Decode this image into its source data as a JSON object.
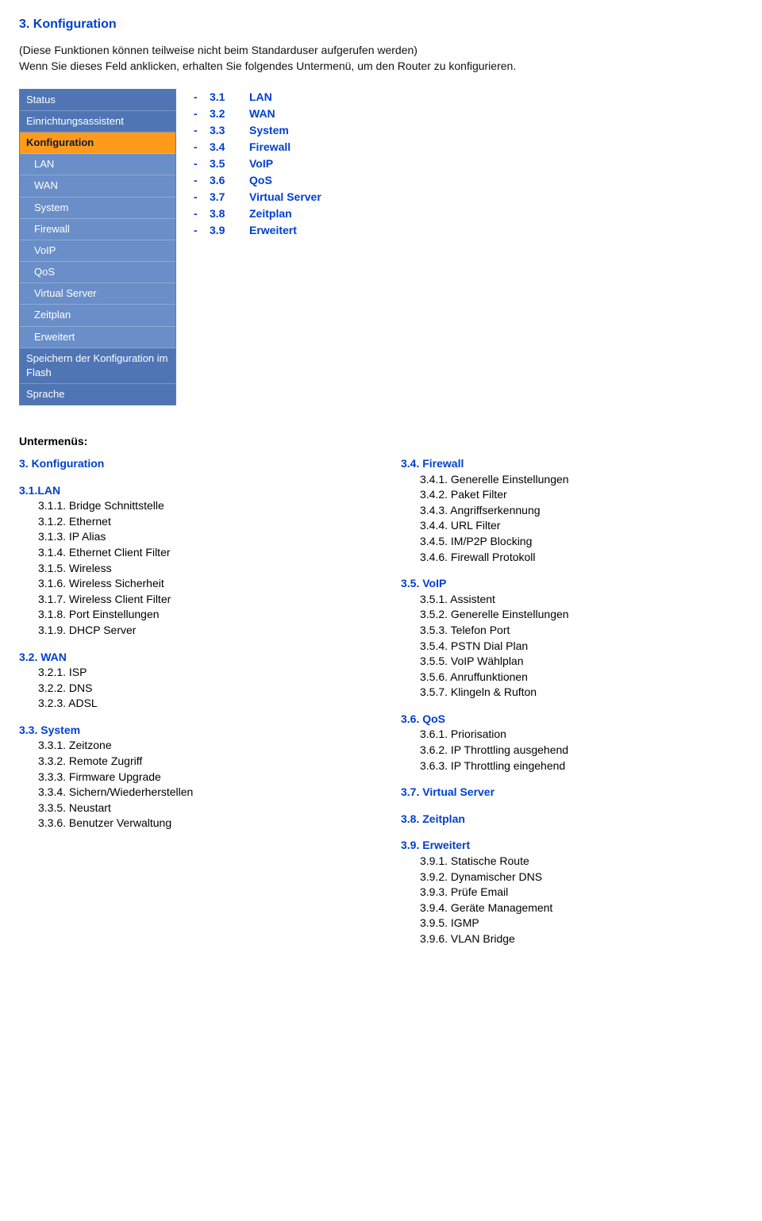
{
  "heading": "3. Konfiguration",
  "intro_line1": "(Diese Funktionen können teilweise nicht beim Standarduser aufgerufen werden)",
  "intro_line2": "Wenn Sie dieses Feld anklicken, erhalten Sie folgendes Untermenü, um den Router zu konfigurieren.",
  "nav": {
    "items": [
      {
        "label": "Status",
        "active": false,
        "sub": false
      },
      {
        "label": "Einrichtungsassistent",
        "active": false,
        "sub": false
      },
      {
        "label": "Konfiguration",
        "active": true,
        "sub": false
      },
      {
        "label": "LAN",
        "active": false,
        "sub": true
      },
      {
        "label": "WAN",
        "active": false,
        "sub": true
      },
      {
        "label": "System",
        "active": false,
        "sub": true
      },
      {
        "label": "Firewall",
        "active": false,
        "sub": true
      },
      {
        "label": "VoIP",
        "active": false,
        "sub": true
      },
      {
        "label": "QoS",
        "active": false,
        "sub": true
      },
      {
        "label": "Virtual Server",
        "active": false,
        "sub": true
      },
      {
        "label": "Zeitplan",
        "active": false,
        "sub": true
      },
      {
        "label": "Erweitert",
        "active": false,
        "sub": true
      },
      {
        "label": "Speichern der Konfiguration im Flash",
        "active": false,
        "sub": false
      },
      {
        "label": "Sprache",
        "active": false,
        "sub": false
      }
    ]
  },
  "main_list": [
    {
      "num": "3.1",
      "label": "LAN"
    },
    {
      "num": "3.2",
      "label": "WAN"
    },
    {
      "num": "3.3",
      "label": "System"
    },
    {
      "num": "3.4",
      "label": "Firewall"
    },
    {
      "num": "3.5",
      "label": "VoIP"
    },
    {
      "num": "3.6",
      "label": "QoS"
    },
    {
      "num": "3.7",
      "label": "Virtual Server"
    },
    {
      "num": "3.8",
      "label": "Zeitplan"
    },
    {
      "num": "3.9",
      "label": "Erweitert"
    }
  ],
  "submenu_label": "Untermenüs:",
  "left_col": [
    {
      "title": "3. Konfiguration",
      "items": []
    },
    {
      "title": "3.1.LAN",
      "items": [
        "3.1.1. Bridge Schnittstelle",
        "3.1.2. Ethernet",
        "3.1.3. IP Alias",
        "3.1.4. Ethernet Client Filter",
        "3.1.5. Wireless",
        "3.1.6. Wireless Sicherheit",
        "3.1.7. Wireless Client Filter",
        "3.1.8. Port Einstellungen",
        "3.1.9. DHCP Server"
      ]
    },
    {
      "title": "3.2. WAN",
      "items": [
        "3.2.1. ISP",
        "3.2.2. DNS",
        "3.2.3. ADSL"
      ]
    },
    {
      "title": "3.3. System",
      "items": [
        "3.3.1. Zeitzone",
        "3.3.2. Remote Zugriff",
        "3.3.3. Firmware Upgrade",
        "3.3.4. Sichern/Wiederherstellen",
        "3.3.5. Neustart",
        "3.3.6. Benutzer Verwaltung"
      ]
    }
  ],
  "right_col": [
    {
      "title": "3.4. Firewall",
      "items": [
        "3.4.1. Generelle Einstellungen",
        "3.4.2. Paket Filter",
        "3.4.3. Angriffserkennung",
        "3.4.4. URL Filter",
        "3.4.5. IM/P2P Blocking",
        "3.4.6. Firewall Protokoll"
      ]
    },
    {
      "title": "3.5. VoIP",
      "items": [
        "3.5.1. Assistent",
        "3.5.2. Generelle Einstellungen",
        "3.5.3. Telefon Port",
        "3.5.4. PSTN Dial Plan",
        "3.5.5. VoIP Wählplan",
        "3.5.6. Anruffunktionen",
        "3.5.7. Klingeln & Rufton"
      ]
    },
    {
      "title": "3.6. QoS",
      "items": [
        "3.6.1. Priorisation",
        "3.6.2. IP Throttling ausgehend",
        "3.6.3. IP Throttling eingehend"
      ]
    },
    {
      "title": "3.7. Virtual Server",
      "items": []
    },
    {
      "title": "3.8. Zeitplan",
      "items": []
    },
    {
      "title": "3.9. Erweitert",
      "items": [
        "3.9.1. Statische Route",
        "3.9.2. Dynamischer DNS",
        "3.9.3. Prüfe Email",
        "3.9.4. Geräte Management",
        "3.9.5. IGMP",
        "3.9.6. VLAN Bridge"
      ]
    }
  ]
}
